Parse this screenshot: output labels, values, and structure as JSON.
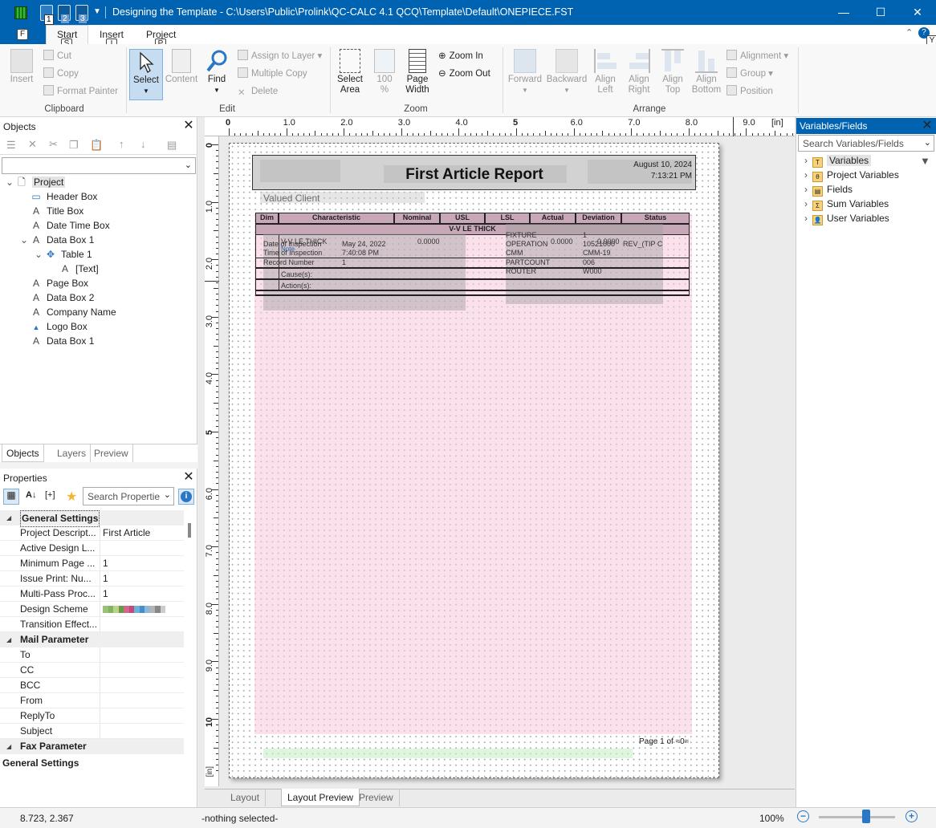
{
  "window": {
    "title": "Designing the Template - C:\\Users\\Public\\Prolink\\QC-CALC 4.1 QCQ\\Template\\Default\\ONEPIECE.FST",
    "qat": [
      "1",
      "2",
      "3"
    ],
    "minimize": "—",
    "maximize": "☐",
    "close": "✕"
  },
  "ribbon_tabs": {
    "file": "F",
    "start": "Start",
    "start_key": "S",
    "insert": "Insert",
    "insert_key": "I",
    "project": "Project",
    "project_key": "P",
    "help_key": "Y"
  },
  "clipboard": {
    "insert": "Insert",
    "cut": "Cut",
    "copy": "Copy",
    "format_painter": "Format Painter",
    "group": "Clipboard"
  },
  "edit": {
    "select": "Select",
    "content": "Content",
    "find": "Find",
    "assign_layer": "Assign to Layer",
    "multiple_copy": "Multiple Copy",
    "delete": "Delete",
    "group": "Edit"
  },
  "zoom": {
    "select_area_1": "Select",
    "select_area_2": "Area",
    "hundred_1": "100",
    "hundred_2": "%",
    "page_width_1": "Page",
    "page_width_2": "Width",
    "zoom_in": "Zoom In",
    "zoom_out": "Zoom Out",
    "group": "Zoom"
  },
  "arrange": {
    "forward": "Forward",
    "backward": "Backward",
    "align_left_1": "Align",
    "align_left_2": "Left",
    "align_right_1": "Align",
    "align_right_2": "Right",
    "align_top_1": "Align",
    "align_top_2": "Top",
    "align_bottom_1": "Align",
    "align_bottom_2": "Bottom",
    "alignment": "Alignment",
    "group_btn": "Group",
    "position": "Position",
    "group": "Arrange"
  },
  "objects": {
    "title": "Objects",
    "tree": [
      {
        "label": "Project",
        "kind": "page",
        "indent": 0,
        "toggle": "v",
        "selected": true
      },
      {
        "label": "Header Box",
        "kind": "rect",
        "indent": 1,
        "toggle": ""
      },
      {
        "label": "Title Box",
        "kind": "A",
        "indent": 1,
        "toggle": ""
      },
      {
        "label": "Date Time Box",
        "kind": "A",
        "indent": 1,
        "toggle": ""
      },
      {
        "label": "Data Box 1",
        "kind": "A",
        "indent": 1,
        "toggle": "v"
      },
      {
        "label": "Table 1",
        "kind": "table",
        "indent": 2,
        "toggle": "v"
      },
      {
        "label": "[Text]",
        "kind": "A",
        "indent": 3,
        "toggle": ""
      },
      {
        "label": "Page Box",
        "kind": "A",
        "indent": 1,
        "toggle": ""
      },
      {
        "label": "Data Box 2",
        "kind": "A",
        "indent": 1,
        "toggle": ""
      },
      {
        "label": "Company Name",
        "kind": "A",
        "indent": 1,
        "toggle": ""
      },
      {
        "label": "Logo Box",
        "kind": "logo",
        "indent": 1,
        "toggle": ""
      },
      {
        "label": "Data Box 1",
        "kind": "A",
        "indent": 1,
        "toggle": ""
      }
    ],
    "tabs": [
      "Objects",
      "Layers",
      "Preview"
    ]
  },
  "properties": {
    "title": "Properties",
    "search_placeholder": "Search Properties",
    "rows": [
      {
        "type": "section",
        "label": "General Settings"
      },
      {
        "type": "row",
        "key": "Project Descript...",
        "value": "First Article"
      },
      {
        "type": "row",
        "key": "Active Design L...",
        "value": ""
      },
      {
        "type": "row",
        "key": "Minimum Page ...",
        "value": "1"
      },
      {
        "type": "row",
        "key": "Issue Print: Nu...",
        "value": "1"
      },
      {
        "type": "row",
        "key": "Multi-Pass Proc...",
        "value": "1"
      },
      {
        "type": "row",
        "key": "Design Scheme",
        "value": "scheme"
      },
      {
        "type": "row",
        "key": "Transition Effect...",
        "value": ""
      },
      {
        "type": "section",
        "label": "Mail Parameter"
      },
      {
        "type": "row",
        "key": "To",
        "value": ""
      },
      {
        "type": "row",
        "key": "CC",
        "value": ""
      },
      {
        "type": "row",
        "key": "BCC",
        "value": ""
      },
      {
        "type": "row",
        "key": "From",
        "value": ""
      },
      {
        "type": "row",
        "key": "ReplyTo",
        "value": ""
      },
      {
        "type": "row",
        "key": "Subject",
        "value": ""
      },
      {
        "type": "section",
        "label": "Fax Parameter"
      }
    ],
    "footer": "General Settings"
  },
  "rulers": {
    "top": [
      "0",
      "1.0",
      "2.0",
      "3.0",
      "4.0",
      "5",
      "6.0",
      "7.0",
      "8.0",
      "9.0"
    ],
    "unit": "[in]",
    "left": [
      "0",
      "1.0",
      "2.0",
      "3.0",
      "4.0",
      "5",
      "6.0",
      "7.0",
      "8.0",
      "9.0",
      "10"
    ]
  },
  "report": {
    "title": "First Article Report",
    "date": "August 10, 2024",
    "time": "7:13:21 PM",
    "client": "Valued Client",
    "columns": [
      "Dim",
      "Characteristic",
      "Nominal",
      "USL",
      "LSL",
      "Actual",
      "Deviation",
      "Status"
    ],
    "band": "V-V LE THICK",
    "ghost": {
      "a": "V-V LE THICK",
      "b": "Date of Inspection",
      "c": "May 24, 2022",
      "d": "Time of Inspection",
      "e": "7:40:08 PM",
      "f": "Record Number",
      "g": "1",
      "h": "Note",
      "i": "Cause(s):",
      "j": "Action(s):",
      "k": "0.0000",
      "l": "FIXTURE",
      "m": "1",
      "n": "OPERATION",
      "o": "0.0000",
      "p": "10521000",
      "q": "REV_(TIP C",
      "r": "CMM",
      "s": "CMM-19",
      "t": "PARTCOUNT",
      "u": "006",
      "v": "ROUTER",
      "w": "W000",
      "x": "0.0000"
    },
    "page_footer": "Page 1 of ≈0≈"
  },
  "bottom_tabs": [
    "Layout",
    "Layout Preview",
    "Preview"
  ],
  "variables": {
    "title": "Variables/Fields",
    "search_placeholder": "Search Variables/Fields",
    "tree": [
      "Variables",
      "Project Variables",
      "Fields",
      "Sum Variables",
      "User Variables"
    ]
  },
  "status": {
    "coords": "8.723, 2.367",
    "selection": "-nothing selected-",
    "zoom": "100%",
    "zoom_level": 0.62
  }
}
